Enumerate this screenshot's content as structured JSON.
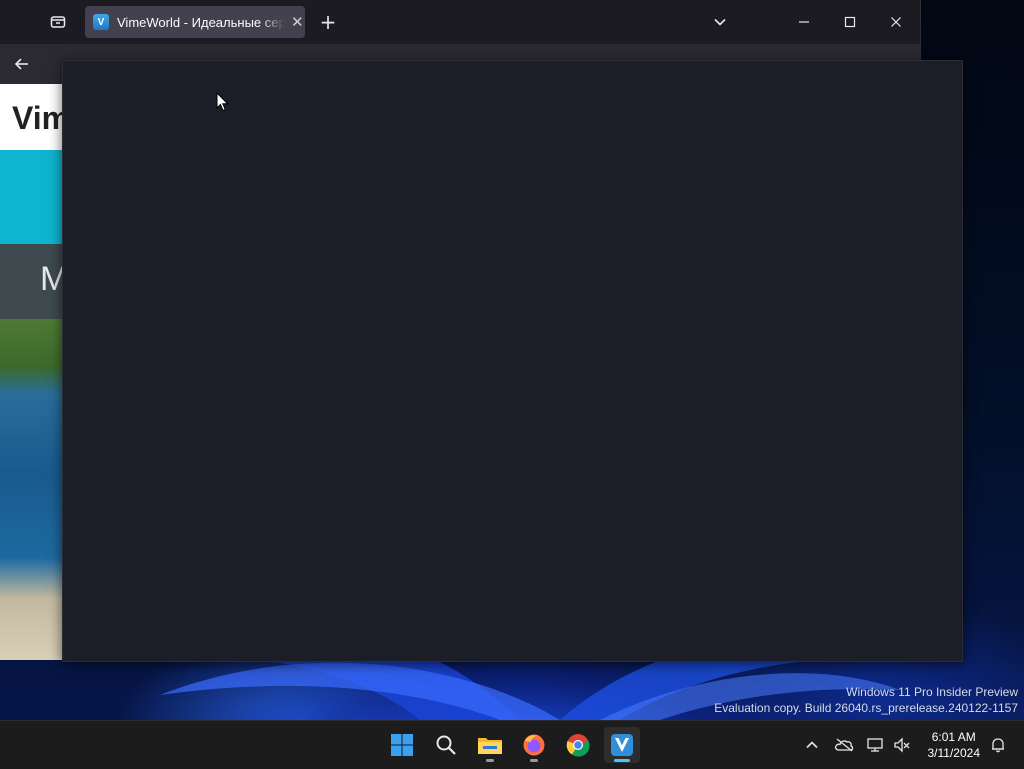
{
  "browser": {
    "tab": {
      "title": "VimeWorld - Идеальные серве",
      "favicon": "vimeworld-logo-icon",
      "close_icon": "close-icon"
    },
    "new_tab_label": "+",
    "window_controls": {
      "list_all_tabs_icon": "chevron-down-icon",
      "minimize_icon": "minimize-icon",
      "maximize_icon": "maximize-icon",
      "close_icon": "close-icon"
    }
  },
  "page": {
    "logo_text": "Vim",
    "menu_letter": "M",
    "colors": {
      "cyan_band": "#0fb4d0",
      "gray_band": "#3f4a4f"
    }
  },
  "modal": {
    "background": "#1b1e27"
  },
  "watermark": {
    "line1": "Windows 11 Pro Insider Preview",
    "line2": "Evaluation copy. Build 26040.rs_prerelease.240122-1157"
  },
  "taskbar": {
    "apps": [
      "start-icon",
      "search-icon",
      "file-explorer-icon",
      "firefox-icon",
      "chrome-icon",
      "vimeworld-launcher-icon"
    ],
    "tray": [
      "chevron-up-icon",
      "onedrive-icon",
      "network-icon",
      "volume-muted-icon",
      "notifications-icon"
    ],
    "time": "6:01 AM",
    "date": "3/11/2024"
  }
}
